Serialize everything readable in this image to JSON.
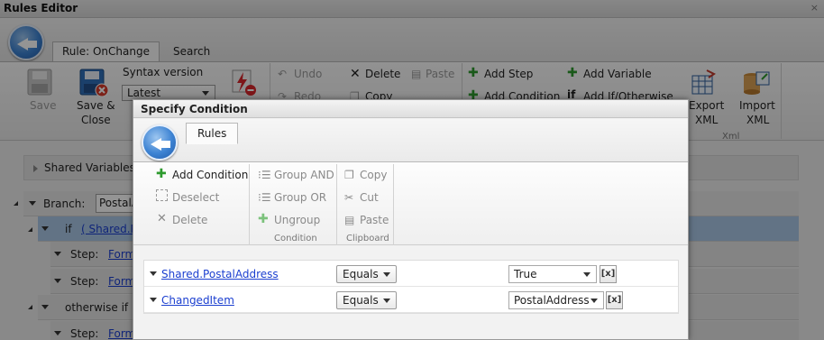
{
  "app": {
    "title": "Rules Editor",
    "close_glyph": "×"
  },
  "bg_tabs": [
    {
      "label": "Rule: OnChange",
      "active": true
    },
    {
      "label": "Search",
      "active": false
    }
  ],
  "bg_ribbon": {
    "save": "Save",
    "save_close_1": "Save &",
    "save_close_2": "Close",
    "syntax_label": "Syntax version",
    "syntax_value": "Latest",
    "undo": "Undo",
    "redo": "Redo",
    "delete": "Delete",
    "copy": "Copy",
    "paste": "Paste",
    "add_step": "Add Step",
    "add_condition": "Add Condition",
    "add_variable": "Add Variable",
    "add_if_otherwise": "Add If/Otherwise",
    "export_1": "Export",
    "export_2": "XML",
    "import_1": "Import",
    "import_2": "XML",
    "group_xml": "Xml"
  },
  "bg_tree": {
    "shared_variables": "Shared Variables",
    "branch_label": "Branch:",
    "branch_value": "PostalA",
    "if_label": "if",
    "if_link": "( Shared.P",
    "step_label": "Step:",
    "step_link": "Form",
    "otherwise_if": "otherwise if"
  },
  "dialog": {
    "title": "Specify Condition",
    "tab": "Rules",
    "ribbon": {
      "add_condition": "Add Condition",
      "deselect": "Deselect",
      "delete": "Delete",
      "group_and": "Group AND",
      "group_or": "Group OR",
      "ungroup": "Ungroup",
      "copy": "Copy",
      "cut": "Cut",
      "paste": "Paste",
      "group_condition": "Condition",
      "group_clipboard": "Clipboard"
    },
    "conditions": [
      {
        "field": "Shared.PostalAddress",
        "operator": "Equals",
        "value": "True",
        "fx": "[x]"
      },
      {
        "field": "ChangedItem",
        "operator": "Equals",
        "value": "PostalAddress",
        "fx": "[x]"
      }
    ]
  },
  "colors": {
    "accent_blue": "#3d83d3",
    "link": "#1b3fd0",
    "selected_row": "#a9c7e6",
    "add_green": "#2e9a2e"
  }
}
